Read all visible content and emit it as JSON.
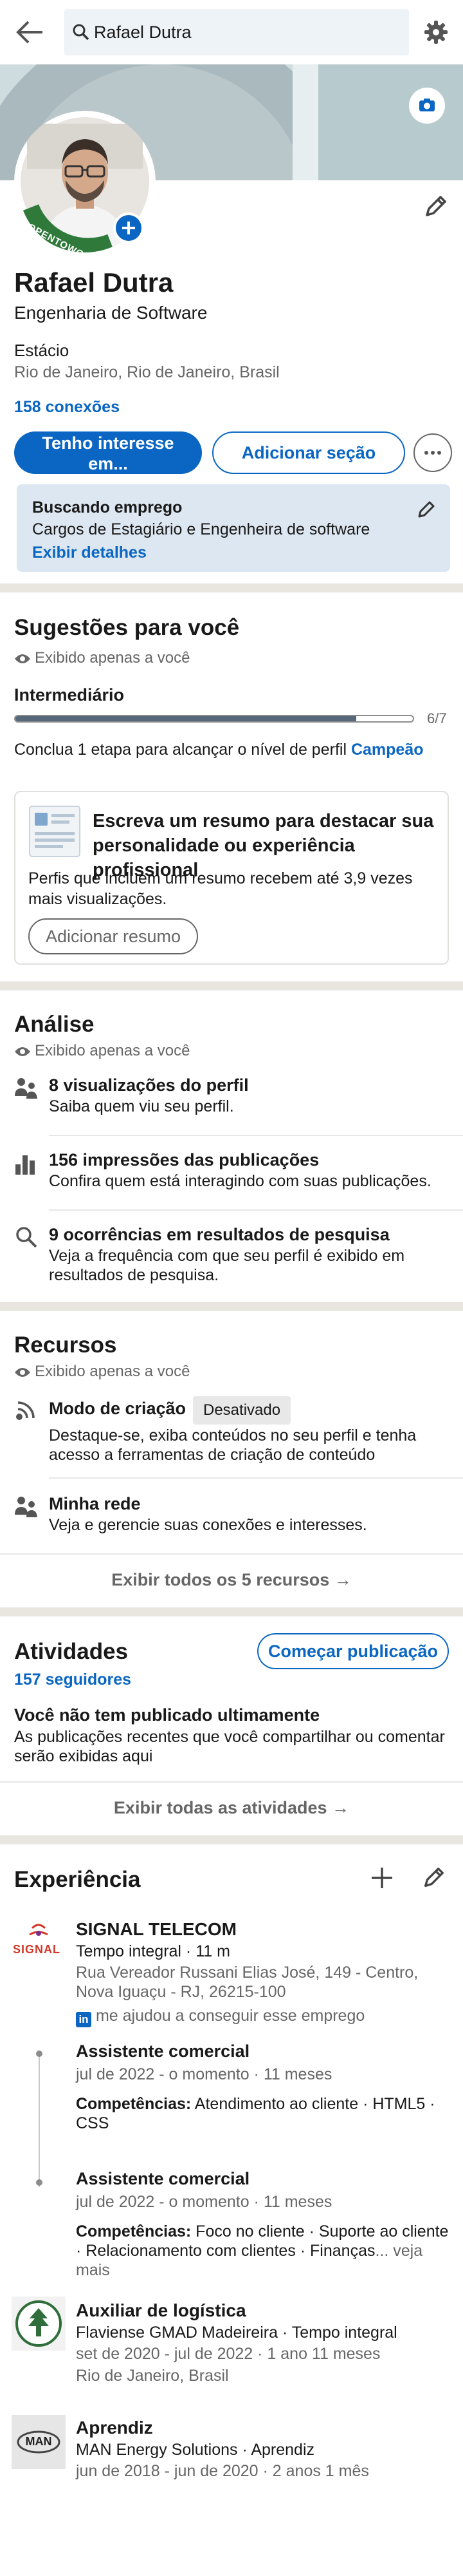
{
  "search": {
    "value": "Rafael Dutra"
  },
  "profile": {
    "name": "Rafael Dutra",
    "headline": "Engenharia de Software",
    "state_label": "Estácio",
    "location": "Rio de Janeiro, Rio de Janeiro, Brasil",
    "connections": "158 conexões",
    "frame_text": "#OPENTOWORK"
  },
  "actions": {
    "interest_label": "Tenho interesse em...",
    "add_section_label": "Adicionar seção"
  },
  "job_search": {
    "title": "Buscando emprego",
    "roles": "Cargos de Estagiário e Engenheira de software",
    "details_link": "Exibir detalhes"
  },
  "suggestions": {
    "title": "Sugestões para você",
    "private_note": "Exibido apenas a você",
    "level": "Intermediário",
    "progress_text": "6/7",
    "progress_value": 0.857,
    "hint_prefix": "Conclua 1 etapa para alcançar o nível de perfil",
    "hint_level": "Campeão",
    "card": {
      "title": "Escreva um resumo para destacar sua personalidade ou experiência profissional",
      "description": "Perfis que incluem um resumo recebem até 3,9 vezes mais visualizações.",
      "button": "Adicionar resumo"
    }
  },
  "analytics": {
    "title": "Análise",
    "private_note": "Exibido apenas a você",
    "items": [
      {
        "title": "8 visualizações do perfil",
        "subtitle": "Saiba quem viu seu perfil."
      },
      {
        "title": "156 impressões das publicações",
        "subtitle": "Confira quem está interagindo com suas publicações."
      },
      {
        "title": "9 ocorrências em resultados de pesquisa",
        "subtitle": "Veja a frequência com que seu perfil é exibido em resultados de pesquisa."
      }
    ]
  },
  "resources": {
    "title": "Recursos",
    "private_note": "Exibido apenas a você",
    "items": [
      {
        "title": "Modo de criação",
        "badge": "Desativado",
        "subtitle": "Destaque-se, exiba conteúdos no seu perfil e tenha acesso a ferramentas de criação de conteúdo"
      },
      {
        "title": "Minha rede",
        "subtitle": "Veja e gerencie suas conexões e interesses."
      }
    ],
    "show_all": "Exibir todos os 5 recursos"
  },
  "activities": {
    "title": "Atividades",
    "followers": "157 seguidores",
    "post_button": "Começar publicação",
    "empty_title": "Você não tem publicado ultimamente",
    "empty_text": "As publicações recentes que você compartilhar ou comentar serão exibidas aqui",
    "show_all": "Exibir todas as atividades"
  },
  "experience": {
    "title": "Experiência",
    "signal": {
      "company": "SIGNAL TELECOM",
      "logo_text": "SIGNAL",
      "meta": "Tempo integral · 11 m",
      "address": "Rua Vereador Russani Elias José, 149 - Centro, Nova Iguaçu - RJ, 26215-100",
      "helped": "me ajudou a conseguir esse emprego",
      "roles": [
        {
          "title": "Assistente comercial",
          "dates": "jul de 2022 - o momento · 11 meses",
          "skills_label": "Competências:",
          "skills": "Atendimento ao cliente · HTML5 · CSS"
        },
        {
          "title": "Assistente comercial",
          "dates": "jul de 2022 - o momento · 11 meses",
          "skills_label": "Competências:",
          "skills": "Foco no cliente · Suporte ao cliente · Relacionamento com clientes · Finanças",
          "more": "... veja mais"
        }
      ]
    },
    "positions": [
      {
        "title": "Auxiliar de logística",
        "company": "Flaviense GMAD Madeireira · Tempo integral",
        "dates": "set de 2020 - jul de 2022 · 1 ano 11 meses",
        "location": "Rio de Janeiro, Brasil"
      },
      {
        "title": "Aprendiz",
        "company": "MAN Energy Solutions · Aprendiz",
        "dates": "jun de 2018 - jun de 2020 · 2 anos 1 mês",
        "logo_text": "MAN"
      }
    ]
  },
  "colors": {
    "brand_blue": "#0a66c2",
    "job_card_bg": "#dde7f1",
    "separator": "#e9e5df"
  }
}
